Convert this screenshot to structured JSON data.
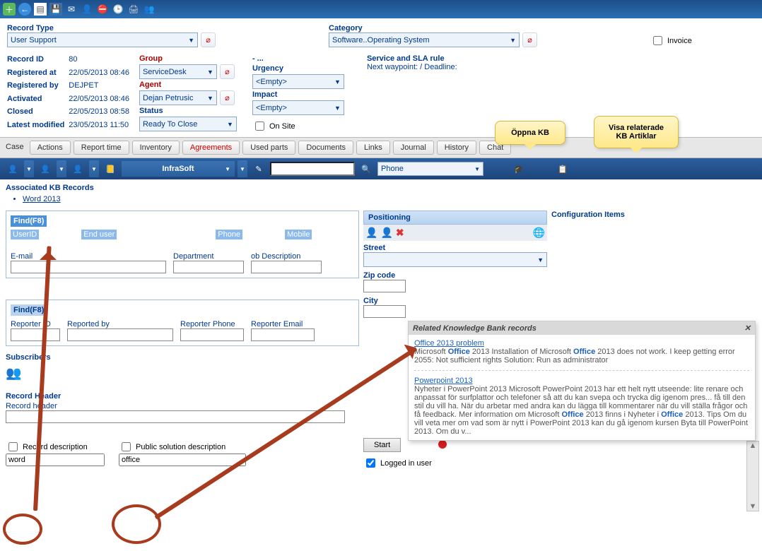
{
  "toolbar_icons": [
    "add",
    "back",
    "new-doc",
    "save",
    "mail",
    "user",
    "stop",
    "clock",
    "print",
    "add-user"
  ],
  "header": {
    "record_type_label": "Record Type",
    "record_type_value": "User Support",
    "category_label": "Category",
    "category_value": "Software..Operating System",
    "invoice_label": "Invoice",
    "record_id_label": "Record ID",
    "record_id_value": "80",
    "registered_at_label": "Registered at",
    "registered_at_value": "22/05/2013 08:46",
    "registered_by_label": "Registered by",
    "registered_by_value": "DEJPET",
    "activated_label": "Activated",
    "activated_value": "22/05/2013 08:46",
    "closed_label": "Closed",
    "closed_value": "22/05/2013 08:58",
    "latest_modified_label": "Latest modified",
    "latest_modified_value": "23/05/2013 11:50",
    "group_label": "Group",
    "group_value": "ServiceDesk",
    "agent_label": "Agent",
    "agent_value": "Dejan Petrusic",
    "status_label": "Status",
    "status_value": "Ready To Close",
    "dash_label": "- ...",
    "urgency_label": "Urgency",
    "urgency_value": "<Empty>",
    "impact_label": "Impact",
    "impact_value": "<Empty>",
    "onsite_label": "On Site",
    "sla_label": "Service and SLA rule",
    "sla_value": "Next waypoint: / Deadline:"
  },
  "callouts": {
    "open_kb": "Öppna KB",
    "show_related": "Visa relaterade KB Artiklar"
  },
  "tabs": [
    "Case",
    "Actions",
    "Report time",
    "Inventory",
    "Agreements",
    "Used parts",
    "Documents",
    "Links",
    "Journal",
    "History",
    "Chat"
  ],
  "darkbar": {
    "company": "InfraSoft",
    "channel": "Phone"
  },
  "associated": {
    "title": "Associated KB Records",
    "items": [
      "Word 2013"
    ]
  },
  "findbox": {
    "title": "Find(F8)",
    "cols": [
      "UserID",
      "End user",
      "Phone",
      "Mobile"
    ],
    "email": "E-mail",
    "department": "Department",
    "jobdesc": "ob Description"
  },
  "findbox2": {
    "title": "Find(F8)",
    "cols": [
      "Reporter ID",
      "Reported by",
      "Reporter Phone",
      "Reporter Email"
    ]
  },
  "subscribers": "Subscribers",
  "record_header": {
    "title": "Record Header",
    "field": "Record header"
  },
  "record_desc": {
    "label": "Record description",
    "value": "word"
  },
  "public_sol": {
    "label": "Public solution description",
    "value": "office"
  },
  "positioning": {
    "title": "Positioning",
    "street": "Street",
    "zip": "Zip code",
    "city": "City"
  },
  "config_items": "Configuration Items",
  "kb_popup": {
    "title": "Related Knowledge Bank records",
    "r1_title": "Office 2013 problem",
    "r1_text_a": "Microsoft ",
    "r1_text_b": " 2013 Installation of Microsoft ",
    "r1_text_c": " 2013 does not work. I keep getting error 2055: Not sufficient rights Solution: Run as administrator",
    "office_word": "Office",
    "r2_title": "Powerpoint 2013",
    "r2_text_a": "Nyheter i PowerPoint 2013 Microsoft PowerPoint 2013 har ett helt nytt utseende: lite renare och anpassat för surfplattor och telefoner så att du kan svepa och trycka dig igenom pres... få till den stil du vill ha. När du arbetar med andra kan du lägga till kommentarer när du vill ställa frågor och få feedback. Mer information om Microsoft ",
    "r2_text_b": " 2013 finns i Nyheter i ",
    "r2_text_c": " 2013. Tips Om du vill veta mer om vad som är nytt i PowerPoint 2013 kan du gå igenom kursen Byta till PowerPoint 2013. Om du v..."
  },
  "start_btn": "Start",
  "logged_in": "Logged in user"
}
